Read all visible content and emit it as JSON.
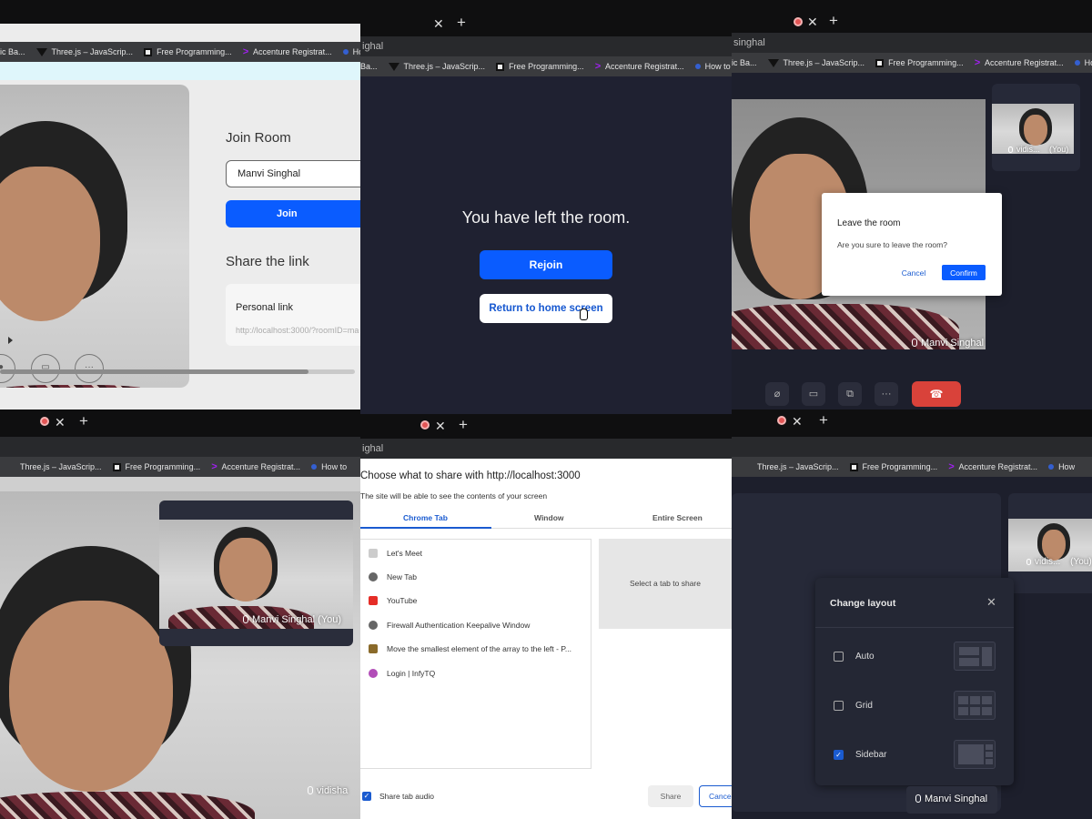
{
  "bookmarks": {
    "threejs": "Three.js – JavaScrip...",
    "free_programming": "Free Programming...",
    "accenture": "Accenture Registrat...",
    "how_to_make": "How to Make",
    "panel1_partial": "ic Ba...",
    "panel2_partial": "Ba...",
    "panel3_partial": "ic Ba...",
    "threejs_p4": "Three.js – JavaScrip...",
    "how_to_p4": "How to",
    "how_to_p6": "How",
    "how_to_p3": "How to Make a"
  },
  "address": {
    "fragment": "ighal",
    "fragment_p3": "singhal"
  },
  "panel1": {
    "join_title": "Join Room",
    "name_value": "Manvi Singhal",
    "join_label": "Join",
    "share_title": "Share the link",
    "personal_link_label": "Personal link",
    "personal_link_url": "http://localhost:3000/?roomID=ma",
    "progress": 0.87
  },
  "panel2": {
    "message": "You have left the room.",
    "rejoin_label": "Rejoin",
    "home_label": "Return to home screen"
  },
  "panel3": {
    "dialog_title": "Leave the room",
    "dialog_message": "Are you sure to leave the room?",
    "cancel_label": "Cancel",
    "confirm_label": "Confirm",
    "main_name": "Manvi Singhal",
    "thumb_name": "vidis...",
    "thumb_you": "(You)"
  },
  "panel4": {
    "pip_name": "Manvi Singhal (You)",
    "main_name": "vidisha"
  },
  "panel5": {
    "heading": "Choose what to share with http://localhost:3000",
    "subheading": "The site will be able to see the contents of your screen",
    "tabs": [
      "Chrome Tab",
      "Window",
      "Entire Screen"
    ],
    "items": [
      "Let's Meet",
      "New Tab",
      "YouTube",
      "Firewall Authentication Keepalive Window",
      "Move the smallest element of the array to the left - P...",
      "Login | InfyTQ"
    ],
    "preview_text": "Select a tab to share",
    "share_audio_label": "Share tab audio",
    "share_label": "Share",
    "cancel_label": "Cance"
  },
  "panel6": {
    "title": "Change layout",
    "options": [
      "Auto",
      "Grid",
      "Sidebar"
    ],
    "checked": "Sidebar",
    "bottom_name": "Manvi Singhal",
    "thumb_name": "vidis...",
    "thumb_you": "(You)"
  },
  "colors": {
    "primary": "#0a5cff",
    "dark_bg": "#1f2131",
    "end_call": "#d9423a"
  }
}
